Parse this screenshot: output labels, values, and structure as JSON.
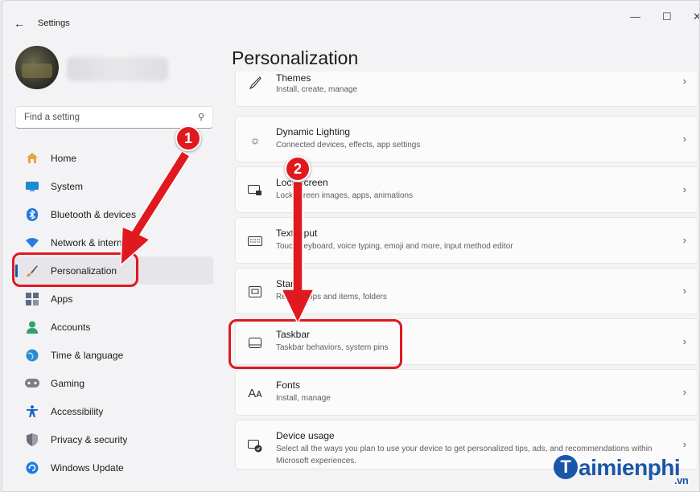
{
  "window": {
    "back_glyph": "←",
    "title": "Settings",
    "minimize": "—",
    "maximize": "☐",
    "close": "✕"
  },
  "user": {
    "name": ""
  },
  "search": {
    "placeholder": "Find a setting",
    "icon": "search-icon"
  },
  "sidebar": {
    "items": [
      {
        "label": "Home",
        "icon": "home-icon",
        "color": "#e8a33d"
      },
      {
        "label": "System",
        "icon": "system-icon",
        "color": "#1f8ad2"
      },
      {
        "label": "Bluetooth & devices",
        "icon": "bluetooth-icon",
        "color": "#1f7ae0"
      },
      {
        "label": "Network & internet",
        "icon": "network-icon",
        "color": "#2a7de1"
      },
      {
        "label": "Personalization",
        "icon": "brush-icon",
        "color": "#d98a3a",
        "active": true
      },
      {
        "label": "Apps",
        "icon": "apps-icon",
        "color": "#5a6b85"
      },
      {
        "label": "Accounts",
        "icon": "accounts-icon",
        "color": "#2fa36b"
      },
      {
        "label": "Time & language",
        "icon": "globe-icon",
        "color": "#2a8bd1"
      },
      {
        "label": "Gaming",
        "icon": "gamepad-icon",
        "color": "#7a7f88"
      },
      {
        "label": "Accessibility",
        "icon": "accessibility-icon",
        "color": "#1763c7"
      },
      {
        "label": "Privacy & security",
        "icon": "shield-icon",
        "color": "#6b6f78"
      },
      {
        "label": "Windows Update",
        "icon": "update-icon",
        "color": "#1f7ae0"
      }
    ]
  },
  "main": {
    "title": "Personalization",
    "cards": [
      {
        "title": "Themes",
        "subtitle": "Install, create, manage",
        "icon": "brush-pen-icon"
      },
      {
        "title": "Dynamic Lighting",
        "subtitle": "Connected devices, effects, app settings",
        "icon": "lighting-icon"
      },
      {
        "title": "Lock screen",
        "subtitle": "Lock screen images, apps, animations",
        "icon": "lock-screen-icon"
      },
      {
        "title": "Text input",
        "subtitle": "Touch keyboard, voice typing, emoji and more, input method editor",
        "icon": "keyboard-icon"
      },
      {
        "title": "Start",
        "subtitle": "Recent apps and items, folders",
        "icon": "start-icon"
      },
      {
        "title": "Taskbar",
        "subtitle": "Taskbar behaviors, system pins",
        "icon": "taskbar-icon"
      },
      {
        "title": "Fonts",
        "subtitle": "Install, manage",
        "icon": "fonts-icon"
      },
      {
        "title": "Device usage",
        "subtitle": "Select all the ways you plan to use your device to get personalized tips, ads, and recommendations within Microsoft experiences.",
        "icon": "device-usage-icon"
      }
    ],
    "chevron": "›"
  },
  "annotations": {
    "step1": "1",
    "step2": "2",
    "accent": "#e0191f"
  },
  "watermark": {
    "initial": "T",
    "text": "aimienphi",
    "suffix": ".vn"
  }
}
